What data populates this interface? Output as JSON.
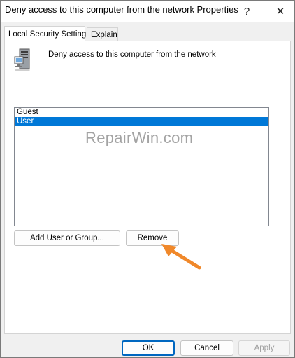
{
  "window": {
    "title": "Deny access to this computer from the network Properties",
    "help_glyph": "?",
    "close_glyph": "✕"
  },
  "tabs": [
    {
      "label": "Local Security Setting",
      "active": true
    },
    {
      "label": "Explain",
      "active": false
    }
  ],
  "policy": {
    "icon": "server-computer-icon",
    "name": "Deny access to this computer from the network"
  },
  "accounts": {
    "items": [
      {
        "label": "Guest",
        "selected": false
      },
      {
        "label": "User",
        "selected": true
      }
    ]
  },
  "watermark": "RepairWin.com",
  "buttons": {
    "add_user_or_group": "Add User or Group...",
    "remove": "Remove",
    "ok": "OK",
    "cancel": "Cancel",
    "apply": "Apply"
  },
  "colors": {
    "selection": "#0078d7",
    "accent_border": "#0067c0",
    "annotation_arrow": "#f0882a"
  }
}
